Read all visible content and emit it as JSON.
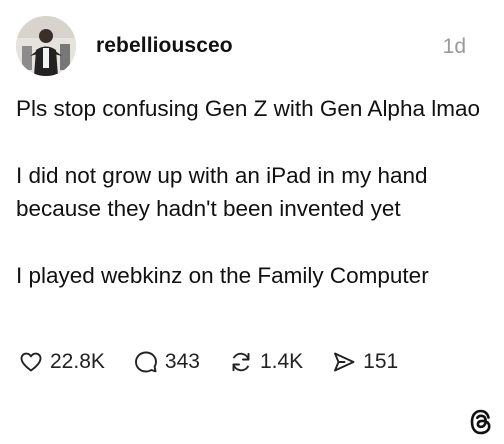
{
  "post": {
    "username": "rebelliousceo",
    "timestamp": "1d",
    "paragraphs": [
      "Pls stop confusing Gen Z with Gen Alpha lmao",
      "I did not grow up with an iPad in my hand because they hadn't been invented yet",
      "I played webkinz on the Family Computer"
    ],
    "actions": {
      "likes": "22.8K",
      "replies": "343",
      "reposts": "1.4K",
      "shares": "151"
    }
  },
  "icons": {
    "like": "heart-icon",
    "reply": "speech-bubble-icon",
    "repost": "repost-arrows-icon",
    "share": "send-icon",
    "brand": "threads-logo-icon"
  }
}
